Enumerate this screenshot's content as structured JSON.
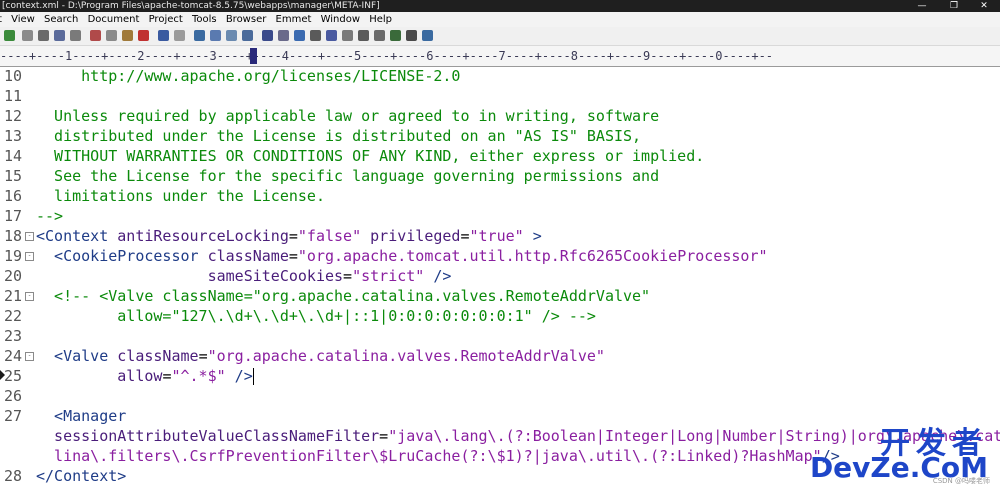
{
  "window": {
    "title": "[context.xml - D:\\Program Files\\apache-tomcat-8.5.75\\webapps\\manager\\META-INF]",
    "controls": [
      "—",
      "❐",
      "✕"
    ]
  },
  "menu": [
    "t",
    "View",
    "Search",
    "Document",
    "Project",
    "Tools",
    "Browser",
    "Emmet",
    "Window",
    "Help"
  ],
  "ruler": {
    "text": "----+----1----+----2----+----3----+----4----+----5----+----6----+----7----+----8----+----9----+----0----+--"
  },
  "editor": {
    "lines": [
      {
        "num": "10",
        "segments": [
          {
            "t": "     http://www.apache.org/licenses/LICENSE-2.0",
            "c": "green"
          }
        ]
      },
      {
        "num": "11",
        "segments": []
      },
      {
        "num": "12",
        "segments": [
          {
            "t": "  Unless required by applicable law or agreed to in writing, software",
            "c": "green"
          }
        ]
      },
      {
        "num": "13",
        "segments": [
          {
            "t": "  distributed under the License is distributed on an \"AS IS\" BASIS,",
            "c": "green"
          }
        ]
      },
      {
        "num": "14",
        "segments": [
          {
            "t": "  WITHOUT WARRANTIES OR CONDITIONS OF ANY KIND, either express or implied.",
            "c": "green"
          }
        ]
      },
      {
        "num": "15",
        "segments": [
          {
            "t": "  See the License for the specific language governing permissions and",
            "c": "green"
          }
        ]
      },
      {
        "num": "16",
        "segments": [
          {
            "t": "  limitations under the License.",
            "c": "green"
          }
        ]
      },
      {
        "num": "17",
        "segments": [
          {
            "t": "-->",
            "c": "green"
          }
        ]
      },
      {
        "num": "18",
        "fold": "-",
        "segments": [
          {
            "t": "<Context ",
            "c": "navy"
          },
          {
            "t": "antiResourceLocking",
            "c": "attr"
          },
          {
            "t": "=",
            "c": "blk"
          },
          {
            "t": "\"false\"",
            "c": "str"
          },
          {
            "t": " privileged",
            "c": "attr"
          },
          {
            "t": "=",
            "c": "blk"
          },
          {
            "t": "\"true\"",
            "c": "str"
          },
          {
            "t": " >",
            "c": "navy"
          }
        ]
      },
      {
        "num": "19",
        "fold": "-",
        "segments": [
          {
            "t": "  <CookieProcessor ",
            "c": "navy"
          },
          {
            "t": "className",
            "c": "attr"
          },
          {
            "t": "=",
            "c": "blk"
          },
          {
            "t": "\"org.apache.tomcat.util.http.Rfc6265CookieProcessor\"",
            "c": "str"
          }
        ]
      },
      {
        "num": "20",
        "segments": [
          {
            "t": "                   sameSiteCookies",
            "c": "attr"
          },
          {
            "t": "=",
            "c": "blk"
          },
          {
            "t": "\"strict\"",
            "c": "str"
          },
          {
            "t": " />",
            "c": "navy"
          }
        ]
      },
      {
        "num": "21",
        "fold": "-",
        "segments": [
          {
            "t": "  <!-- <Valve className=\"org.apache.catalina.valves.RemoteAddrValve\"",
            "c": "green"
          }
        ]
      },
      {
        "num": "22",
        "segments": [
          {
            "t": "         allow=\"127\\.\\d+\\.\\d+\\.\\d+|::1|0:0:0:0:0:0:0:1\" /> -->",
            "c": "green"
          }
        ]
      },
      {
        "num": "23",
        "segments": []
      },
      {
        "num": "24",
        "fold": "-",
        "segments": [
          {
            "t": "  <Valve ",
            "c": "navy"
          },
          {
            "t": "className",
            "c": "attr"
          },
          {
            "t": "=",
            "c": "blk"
          },
          {
            "t": "\"org.apache.catalina.valves.RemoteAddrValve\"",
            "c": "str"
          }
        ]
      },
      {
        "num": "25",
        "current": true,
        "segments": [
          {
            "t": "         allow",
            "c": "attr"
          },
          {
            "t": "=",
            "c": "blk"
          },
          {
            "t": "\"^.*$\"",
            "c": "str"
          },
          {
            "t": " />",
            "c": "navy"
          }
        ]
      },
      {
        "num": "26",
        "segments": []
      },
      {
        "num": "27",
        "segments": [
          {
            "t": "  <Manager",
            "c": "navy"
          }
        ]
      },
      {
        "num": "",
        "segments": [
          {
            "t": "  sessionAttributeValueClassNameFilter",
            "c": "attr"
          },
          {
            "t": "=",
            "c": "blk"
          },
          {
            "t": "\"java\\.lang\\.(?:Boolean|Integer|Long|Number|String)|org\\.apache\\.cata",
            "c": "str"
          }
        ]
      },
      {
        "num": "",
        "segments": [
          {
            "t": "  lina\\.filters\\.CsrfPreventionFilter\\$LruCache(?:\\$1)?|java\\.util\\.(?:Linked)?HashMap\"",
            "c": "str"
          },
          {
            "t": "/>",
            "c": "navy"
          }
        ]
      },
      {
        "num": "28",
        "segments": [
          {
            "t": "</Context>",
            "c": "navy"
          }
        ]
      }
    ]
  },
  "watermark": {
    "cn": "开发者",
    "en": "DevZe.CoM",
    "small": "CSDN @吗喽老师"
  },
  "colors": {
    "comment": "#0b8a0b",
    "tag": "#1f3c87",
    "attribute": "#4a1d7a",
    "string": "#8a1fa0"
  }
}
